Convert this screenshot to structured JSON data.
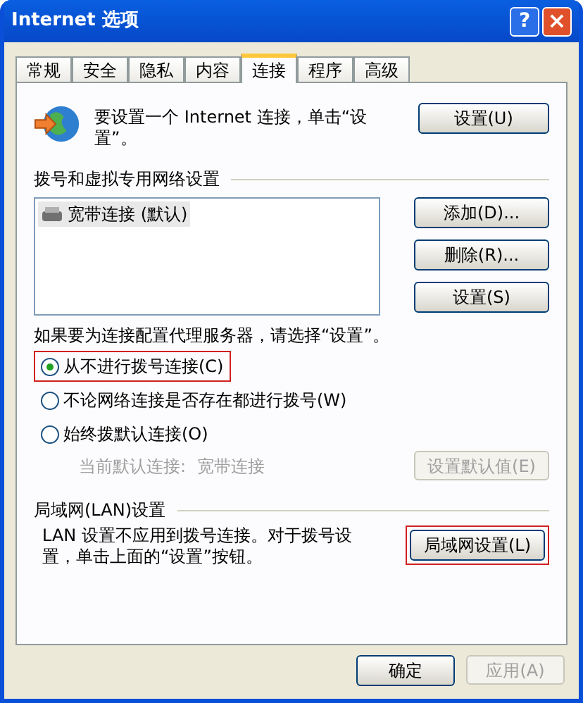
{
  "window": {
    "title": "Internet 选项",
    "help": "?",
    "close": "×"
  },
  "tabs": [
    {
      "label": "常规",
      "selected": false
    },
    {
      "label": "安全",
      "selected": false
    },
    {
      "label": "隐私",
      "selected": false
    },
    {
      "label": "内容",
      "selected": false
    },
    {
      "label": "连接",
      "selected": true
    },
    {
      "label": "程序",
      "selected": false
    },
    {
      "label": "高级",
      "selected": false
    }
  ],
  "setup": {
    "text": "要设置一个 Internet 连接，单击“设置”。",
    "button": "设置(U)"
  },
  "dialup": {
    "heading": "拨号和虚拟专用网络设置",
    "connections": [
      {
        "label": "宽带连接 (默认)",
        "selected": true
      }
    ],
    "buttons": [
      {
        "label": "添加(D)..."
      },
      {
        "label": "删除(R)..."
      },
      {
        "label": "设置(S)"
      }
    ],
    "proxy_note": "如果要为连接配置代理服务器，请选择“设置”。",
    "options": [
      {
        "label": "从不进行拨号连接(C)",
        "selected": true,
        "highlighted": true
      },
      {
        "label": "不论网络连接是否存在都进行拨号(W)",
        "selected": false,
        "highlighted": false
      },
      {
        "label": "始终拨默认连接(O)",
        "selected": false,
        "highlighted": false
      }
    ],
    "current_label": "当前默认连接:",
    "current_value": "宽带连接",
    "default_button": {
      "label": "设置默认值(E)",
      "disabled": true
    }
  },
  "lan": {
    "heading": "局域网(LAN)设置",
    "text": "LAN 设置不应用到拨号连接。对于拨号设置，单击上面的“设置”按钮。",
    "button": {
      "label": "局域网设置(L)",
      "highlighted": true
    }
  },
  "footer": [
    {
      "label": "确定",
      "disabled": false
    },
    {
      "label": "应用(A)",
      "disabled": true
    }
  ]
}
